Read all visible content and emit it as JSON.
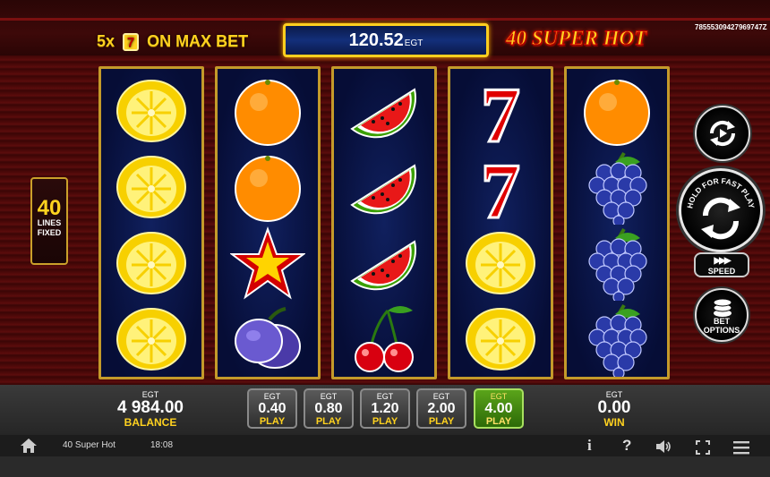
{
  "header": {
    "jackpot_prefix": "5x",
    "jackpot_seven": "7",
    "jackpot_suffix": "ON MAX BET",
    "credit_value": "120.52",
    "credit_currency": "EGT",
    "logo_text": "40 SUPER HOT",
    "ticket_id": "78555309427969747Z"
  },
  "lines": {
    "count": "40",
    "label_line1": "LINES",
    "label_line2": "FIXED"
  },
  "reels": [
    [
      "lemon",
      "lemon",
      "lemon",
      "lemon"
    ],
    [
      "orange",
      "orange",
      "star",
      "plum"
    ],
    [
      "watermelon",
      "watermelon",
      "watermelon",
      "cherries"
    ],
    [
      "seven",
      "seven",
      "lemon",
      "lemon"
    ],
    [
      "orange",
      "grapes",
      "grapes",
      "grapes"
    ]
  ],
  "controls": {
    "hold_text": "HOLD FOR FAST PLAY",
    "speed_label": "SPEED",
    "options_line1": "BET",
    "options_line2": "OPTIONS"
  },
  "balance": {
    "currency": "EGT",
    "amount": "4 984.00",
    "label": "BALANCE"
  },
  "win": {
    "currency": "EGT",
    "amount": "0.00",
    "label": "WIN"
  },
  "bets": [
    {
      "currency": "EGT",
      "amount": "0.40",
      "label": "PLAY",
      "active": false
    },
    {
      "currency": "EGT",
      "amount": "0.80",
      "label": "PLAY",
      "active": false
    },
    {
      "currency": "EGT",
      "amount": "1.20",
      "label": "PLAY",
      "active": false
    },
    {
      "currency": "EGT",
      "amount": "2.00",
      "label": "PLAY",
      "active": false
    },
    {
      "currency": "EGT",
      "amount": "4.00",
      "label": "PLAY",
      "active": true
    }
  ],
  "statusbar": {
    "game_name": "40 Super Hot",
    "clock": "18:08",
    "icons": [
      "home-icon",
      "info-icon",
      "help-icon",
      "sound-icon",
      "fullscreen-icon",
      "menu-icon"
    ]
  },
  "colors": {
    "accent_gold": "#ffd21f",
    "active_green": "#5aa41a",
    "reel_bg": "#0b1a4a",
    "frame_gold": "#c49a2a"
  }
}
